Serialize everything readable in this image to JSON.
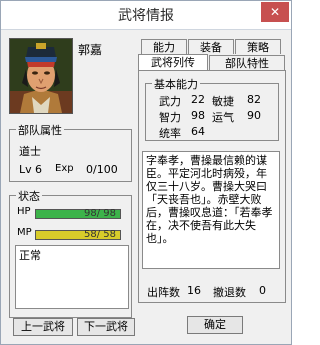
{
  "window": {
    "title": "武将情报",
    "close_glyph": "✕"
  },
  "general": {
    "name": "郭嘉"
  },
  "tabs_top": [
    {
      "label": "能力"
    },
    {
      "label": "装备"
    },
    {
      "label": "策略"
    }
  ],
  "tabs_bottom": [
    {
      "label": "武将列传"
    },
    {
      "label": "部队特性"
    }
  ],
  "unit": {
    "group_label": "部队属性",
    "type": "道士",
    "lv_label": "Lv",
    "lv": "6",
    "exp_label": "Exp",
    "exp": "0/100"
  },
  "status": {
    "group_label": "状态",
    "hp_label": "HP",
    "hp_text": "98/ 98",
    "hp_fraction": 1.0,
    "mp_label": "MP",
    "mp_text": "58/ 58",
    "mp_fraction": 1.0,
    "condition": "正常"
  },
  "abilities": {
    "group_label": "基本能力",
    "force_label": "武力",
    "force": "22",
    "agility_label": "敏捷",
    "agility": "82",
    "intellect_label": "智力",
    "intellect": "98",
    "luck_label": "运气",
    "luck": "90",
    "command_label": "统率",
    "command": "64"
  },
  "bio": "字奉孝，曹操最信赖的谋臣。平定河北时病殁，年仅三十八岁。曹操大哭曰「天丧吾也」。赤壁大败后，曹操叹息道：「若奉孝在，决不使吾有此大失也」。",
  "record": {
    "battles_label": "出阵数",
    "battles": "16",
    "retreats_label": "撤退数",
    "retreats": "0"
  },
  "buttons": {
    "prev": "上一武将",
    "next": "下一武将",
    "ok": "确定"
  },
  "colors": {
    "hp_bar": "#3cb34a",
    "mp_bar": "#d8cc2a",
    "close_bg": "#c75050"
  }
}
